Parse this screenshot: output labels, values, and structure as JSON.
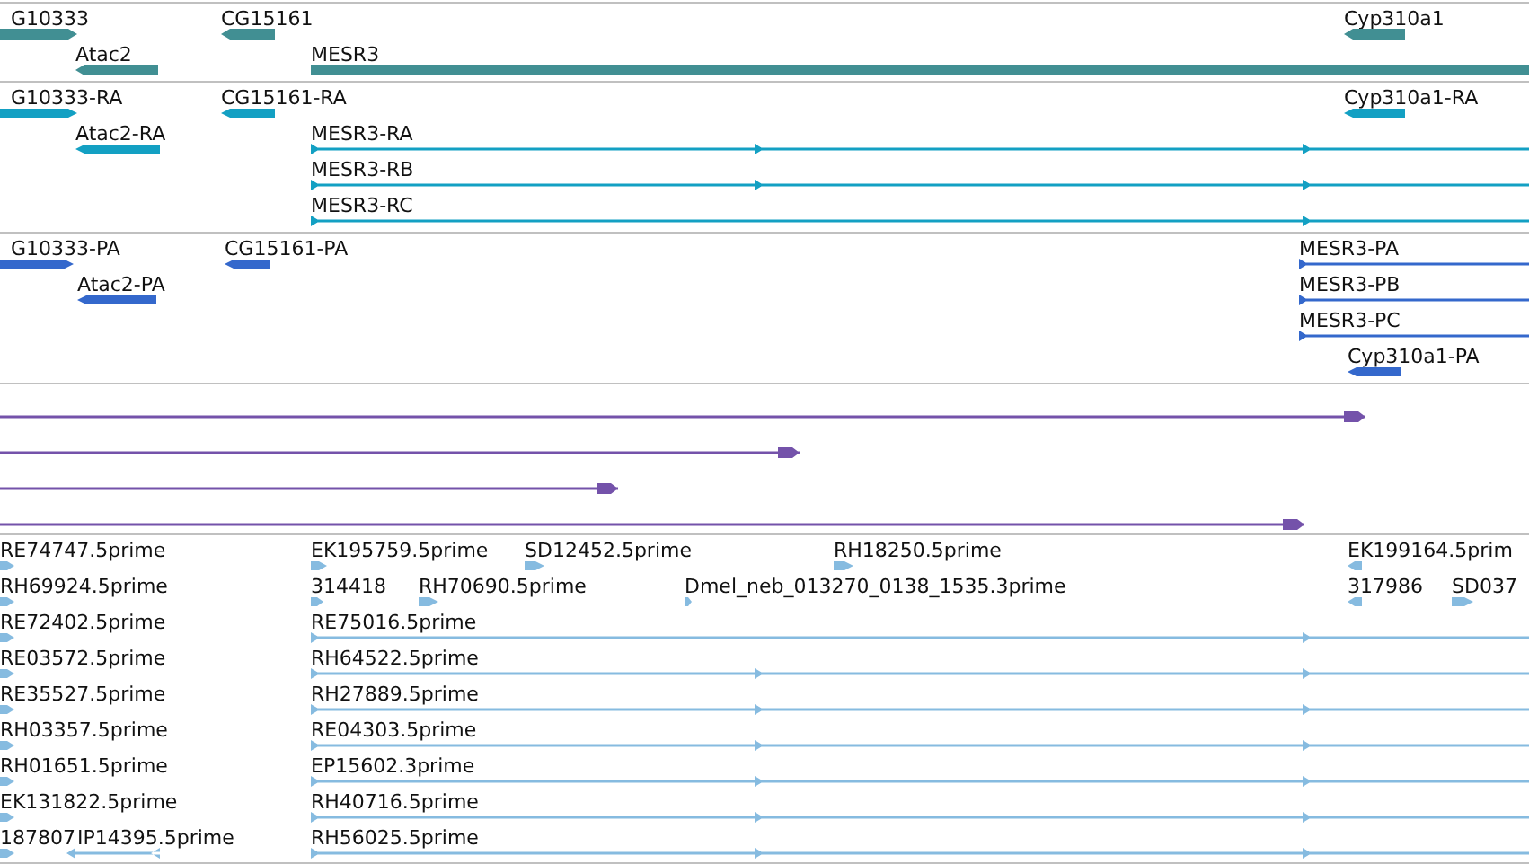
{
  "tracks": [
    {
      "kind": "genes",
      "features": [
        {
          "label": "G10333",
          "reverse_strand": false
        },
        {
          "label": "CG15161",
          "reverse_strand": true
        },
        {
          "label": "Atac2",
          "reverse_strand": true
        },
        {
          "label": "MESR3"
        },
        {
          "label": "Cyp310a1",
          "reverse_strand": true
        }
      ]
    },
    {
      "kind": "transcripts",
      "features": [
        {
          "label": "G10333-RA",
          "reverse_strand": false
        },
        {
          "label": "CG15161-RA",
          "reverse_strand": true
        },
        {
          "label": "Atac2-RA",
          "reverse_strand": true
        },
        {
          "label": "Cyp310a1-RA",
          "reverse_strand": true
        },
        {
          "label": "MESR3-RA",
          "reverse_strand": false
        },
        {
          "label": "MESR3-RB",
          "reverse_strand": false
        },
        {
          "label": "MESR3-RC",
          "reverse_strand": false
        }
      ]
    },
    {
      "kind": "proteins",
      "features": [
        {
          "label": "G10333-PA",
          "reverse_strand": false
        },
        {
          "label": "CG15161-PA",
          "reverse_strand": true
        },
        {
          "label": "Atac2-PA",
          "reverse_strand": true
        },
        {
          "label": "MESR3-PA",
          "reverse_strand": false
        },
        {
          "label": "MESR3-PB",
          "reverse_strand": false
        },
        {
          "label": "MESR3-PC",
          "reverse_strand": false
        },
        {
          "label": "Cyp310a1-PA",
          "reverse_strand": true
        }
      ]
    },
    {
      "kind": "alignments",
      "features": [
        {
          "reverse_strand": false
        },
        {
          "reverse_strand": false
        },
        {
          "reverse_strand": false
        },
        {
          "reverse_strand": false
        }
      ]
    },
    {
      "kind": "ests",
      "features": [
        {
          "label": "RE74747.5prime",
          "reverse_strand": false
        },
        {
          "label": "EK195759.5prime",
          "reverse_strand": false
        },
        {
          "label": "SD12452.5prime",
          "reverse_strand": false
        },
        {
          "label": "RH18250.5prime",
          "reverse_strand": false
        },
        {
          "label": "EK199164.5prim",
          "reverse_strand": true
        },
        {
          "label": "RH69924.5prime",
          "reverse_strand": false
        },
        {
          "label": "314418",
          "reverse_strand": false
        },
        {
          "label": "RH70690.5prime",
          "reverse_strand": false
        },
        {
          "label": "Dmel_neb_013270_0138_1535.3prime",
          "reverse_strand": false
        },
        {
          "label": "317986",
          "reverse_strand": true
        },
        {
          "label": "SD037",
          "reverse_strand": false
        },
        {
          "label": "RE72402.5prime",
          "reverse_strand": false
        },
        {
          "label": "RE75016.5prime",
          "reverse_strand": false
        },
        {
          "label": "RE03572.5prime",
          "reverse_strand": false
        },
        {
          "label": "RH64522.5prime",
          "reverse_strand": false
        },
        {
          "label": "RE35527.5prime",
          "reverse_strand": false
        },
        {
          "label": "RH27889.5prime",
          "reverse_strand": false
        },
        {
          "label": "RH03357.5prime",
          "reverse_strand": false
        },
        {
          "label": "RE04303.5prime",
          "reverse_strand": false
        },
        {
          "label": "RH01651.5prime",
          "reverse_strand": false
        },
        {
          "label": "EP15602.3prime",
          "reverse_strand": false
        },
        {
          "label": "EK131822.5prime",
          "reverse_strand": false
        },
        {
          "label": "RH40716.5prime",
          "reverse_strand": false
        },
        {
          "label": "187807",
          "reverse_strand": false
        },
        {
          "label": "IP14395.5prime",
          "reverse_strand": true
        },
        {
          "label": "RH56025.5prime",
          "reverse_strand": false
        }
      ]
    }
  ]
}
